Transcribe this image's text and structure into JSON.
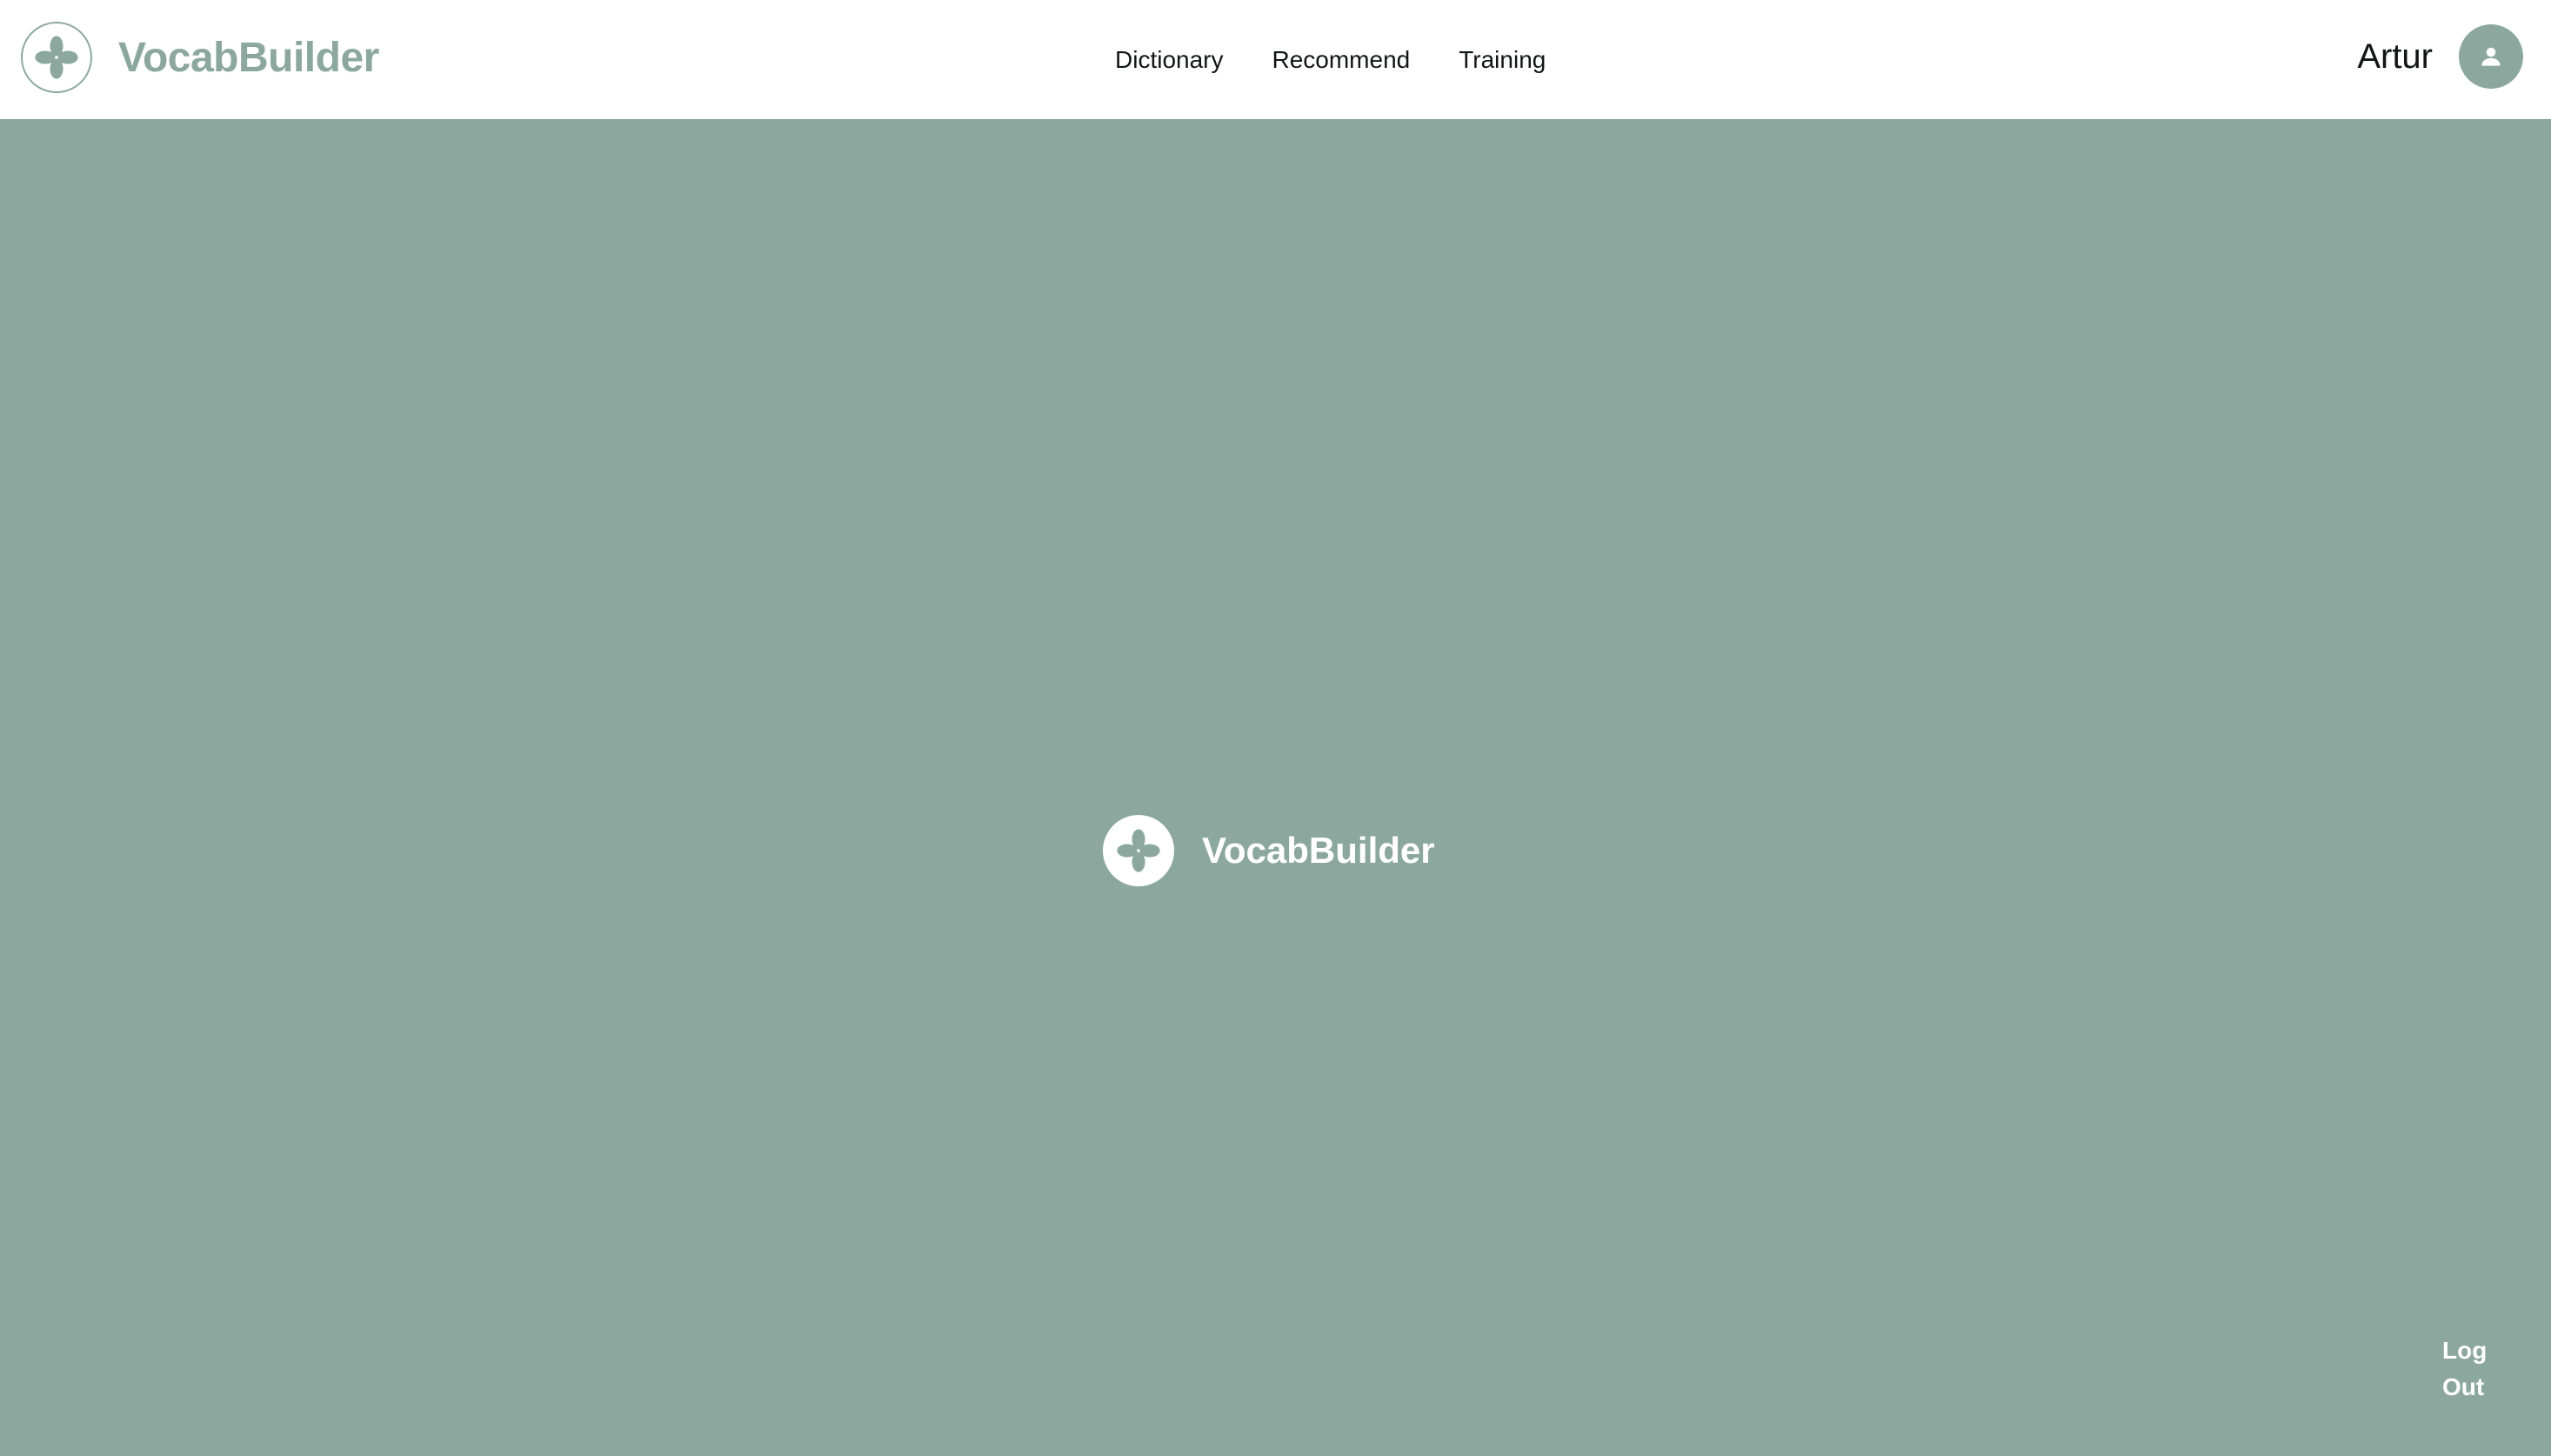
{
  "app": {
    "title": "VocabBuilder",
    "brand_color": "#8ca89e",
    "header_bg": "#ffffff"
  },
  "header": {
    "logo_icon": "flower-logo-icon",
    "brand_name": "VocabBuilder",
    "nav": [
      {
        "label": "Dictionary"
      },
      {
        "label": "Recommend"
      },
      {
        "label": "Training"
      }
    ],
    "user": {
      "name": "Artur",
      "avatar_icon": "user-icon"
    }
  },
  "main": {
    "background": "#8ca89e",
    "center_logo_icon": "flower-logo-icon",
    "center_brand_name": "VocabBuilder",
    "logout_label": "Log Out"
  }
}
